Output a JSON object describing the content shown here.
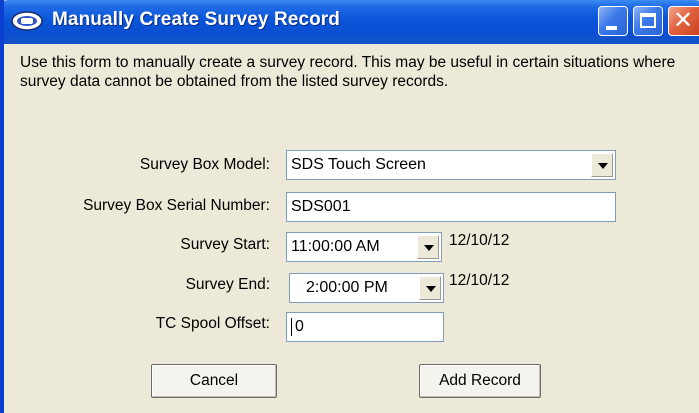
{
  "window": {
    "title": "Manually Create Survey Record",
    "icon": "survey-app-icon",
    "controls": [
      "minimize-icon",
      "maximize-icon",
      "close-icon"
    ],
    "accent": "#0a55d8"
  },
  "description": "Use this form to manually create a survey record.  This may be useful in certain situations where survey data cannot be obtained from the listed survey records.",
  "form": {
    "box_model": {
      "label": "Survey Box Model:",
      "value": "SDS Touch Screen"
    },
    "serial_number": {
      "label": "Survey Box Serial Number:",
      "value": "SDS001"
    },
    "survey_start": {
      "label": "Survey Start:",
      "time": "11:00:00 AM",
      "date": "12/10/12"
    },
    "survey_end": {
      "label": "Survey End:",
      "time": "2:00:00 PM",
      "date": "12/10/12"
    },
    "spool_offset": {
      "label": "TC Spool Offset:",
      "value": "0"
    }
  },
  "buttons": {
    "cancel": "Cancel",
    "add_record": "Add Record"
  }
}
